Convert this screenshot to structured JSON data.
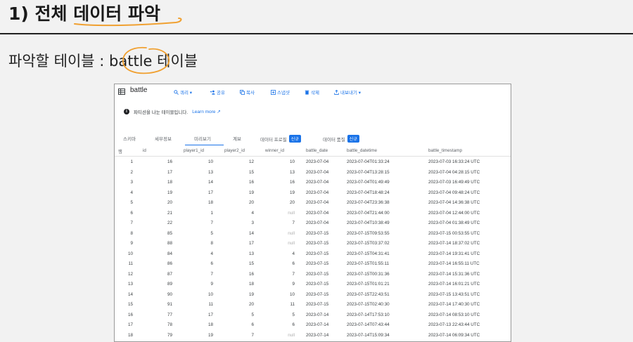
{
  "slide": {
    "title_prefix": "1) 전체 ",
    "title_highlight": "데이터 파악",
    "subheading_prefix": "파악할 테이블 : ",
    "subheading_highlight": "battle",
    "subheading_suffix": " 테이블"
  },
  "panel": {
    "table_name": "battle",
    "toolbar": [
      {
        "icon": "search-icon",
        "label": "쿼리 ▾"
      },
      {
        "icon": "add-person-icon",
        "label": "공유"
      },
      {
        "icon": "copy-icon",
        "label": "복사"
      },
      {
        "icon": "snapshot-icon",
        "label": "스냅샷"
      },
      {
        "icon": "trash-icon",
        "label": "삭제"
      },
      {
        "icon": "export-icon",
        "label": "내보내기 ▾"
      }
    ],
    "info_text": "파티션을 나눈 테이블입니다.",
    "info_link": "Learn more ↗",
    "tabs": [
      {
        "label": "스키마",
        "badge": ""
      },
      {
        "label": "세부정보",
        "badge": ""
      },
      {
        "label": "미리보기",
        "badge": ""
      },
      {
        "label": "계보",
        "badge": ""
      },
      {
        "label": "데이터 프로필",
        "badge": "신규"
      },
      {
        "label": "데이터 품질",
        "badge": "신규"
      }
    ],
    "columns": [
      "행",
      "id",
      "player1_id",
      "player2_id",
      "winner_id",
      "battle_date",
      "battle_datetime",
      "battle_timestamp"
    ],
    "rows": [
      [
        "1",
        "16",
        "10",
        "12",
        "10",
        "2023-07-04",
        "2023-07-04T01:33:24",
        "2023-07-03 16:33:24 UTC"
      ],
      [
        "2",
        "17",
        "13",
        "15",
        "13",
        "2023-07-04",
        "2023-07-04T13:28:15",
        "2023-07-04 04:28:15 UTC"
      ],
      [
        "3",
        "18",
        "14",
        "16",
        "16",
        "2023-07-04",
        "2023-07-04T01:49:49",
        "2023-07-03 16:49:49 UTC"
      ],
      [
        "4",
        "19",
        "17",
        "19",
        "19",
        "2023-07-04",
        "2023-07-04T18:48:24",
        "2023-07-04 09:48:24 UTC"
      ],
      [
        "5",
        "20",
        "18",
        "20",
        "20",
        "2023-07-04",
        "2023-07-04T23:36:38",
        "2023-07-04 14:36:38 UTC"
      ],
      [
        "6",
        "21",
        "1",
        "4",
        "null",
        "2023-07-04",
        "2023-07-04T21:44:00",
        "2023-07-04 12:44:00 UTC"
      ],
      [
        "7",
        "22",
        "7",
        "3",
        "7",
        "2023-07-04",
        "2023-07-04T10:38:49",
        "2023-07-04 01:38:49 UTC"
      ],
      [
        "8",
        "85",
        "5",
        "14",
        "null",
        "2023-07-15",
        "2023-07-15T09:53:55",
        "2023-07-15 00:53:55 UTC"
      ],
      [
        "9",
        "88",
        "8",
        "17",
        "null",
        "2023-07-15",
        "2023-07-15T03:37:02",
        "2023-07-14 18:37:02 UTC"
      ],
      [
        "10",
        "84",
        "4",
        "13",
        "4",
        "2023-07-15",
        "2023-07-15T04:31:41",
        "2023-07-14 19:31:41 UTC"
      ],
      [
        "11",
        "86",
        "6",
        "15",
        "6",
        "2023-07-15",
        "2023-07-15T01:55:11",
        "2023-07-14 16:55:11 UTC"
      ],
      [
        "12",
        "87",
        "7",
        "16",
        "7",
        "2023-07-15",
        "2023-07-15T00:31:36",
        "2023-07-14 15:31:36 UTC"
      ],
      [
        "13",
        "89",
        "9",
        "18",
        "9",
        "2023-07-15",
        "2023-07-15T01:01:21",
        "2023-07-14 16:01:21 UTC"
      ],
      [
        "14",
        "90",
        "10",
        "19",
        "10",
        "2023-07-15",
        "2023-07-15T22:43:51",
        "2023-07-15 13:43:51 UTC"
      ],
      [
        "15",
        "91",
        "11",
        "20",
        "11",
        "2023-07-15",
        "2023-07-15T02:40:30",
        "2023-07-14 17:40:30 UTC"
      ],
      [
        "16",
        "77",
        "17",
        "5",
        "5",
        "2023-07-14",
        "2023-07-14T17:53:10",
        "2023-07-14 08:53:10 UTC"
      ],
      [
        "17",
        "78",
        "18",
        "6",
        "6",
        "2023-07-14",
        "2023-07-14T07:43:44",
        "2023-07-13 22:43:44 UTC"
      ],
      [
        "18",
        "79",
        "19",
        "7",
        "null",
        "2023-07-14",
        "2023-07-14T15:09:34",
        "2023-07-14 06:09:34 UTC"
      ]
    ]
  },
  "colors": {
    "annotation": "#f0a030",
    "link": "#1a73e8",
    "background": "#f2f2f2"
  }
}
